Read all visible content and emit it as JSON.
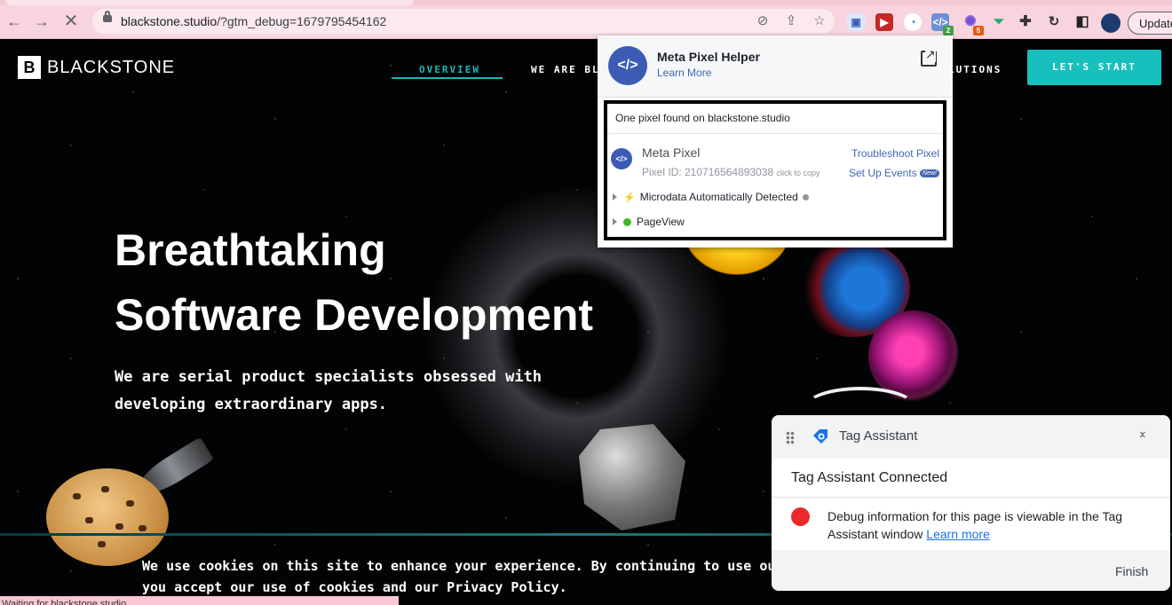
{
  "browser": {
    "url_host": "blackstone.studio",
    "url_path": "/?gtm_debug=1679795454162",
    "update_label": "Update",
    "status_text": "Waiting for blackstone.studio...",
    "extensions": [
      {
        "icon": "extension-icon-1"
      },
      {
        "icon": "extension-icon-2"
      },
      {
        "icon": "extension-icon-3"
      },
      {
        "icon": "meta-pixel-helper-icon",
        "badge": "2"
      },
      {
        "icon": "extension-icon-5",
        "badge": "5"
      },
      {
        "icon": "extension-icon-6"
      },
      {
        "icon": "puzzle-icon"
      }
    ]
  },
  "site": {
    "logo_mark": "B",
    "logo_text": "BLACKSTONE",
    "nav": {
      "overview": "OVERVIEW",
      "we_are": "WE ARE BL",
      "solutions": "LUTIONS"
    },
    "cta": "LET'S START",
    "hero": {
      "line1": "Breathtaking",
      "line2": "Software Development",
      "sub1": "We are serial product specialists obsessed with",
      "sub2": "developing extraordinary apps."
    },
    "cookie": {
      "line1": "We use cookies on this site to enhance your experience. By continuing to use ou",
      "line2": "you accept our use of cookies and our Privacy Policy."
    }
  },
  "pixel_helper": {
    "title": "Meta Pixel Helper",
    "learn_more": "Learn More",
    "found": "One pixel found on blackstone.studio",
    "pixel_name": "Meta Pixel",
    "pixel_id": "Pixel ID: 210716564893038",
    "click_to_copy": "click to copy",
    "troubleshoot": "Troubleshoot Pixel",
    "setup_events": "Set Up Events",
    "new_badge": "New!",
    "microdata": "Microdata Automatically Detected",
    "pageview": "PageView"
  },
  "tag_assistant": {
    "title": "Tag Assistant",
    "connected": "Tag Assistant Connected",
    "message": "Debug information for this page is viewable in the Tag Assistant window",
    "learn_more": "Learn more",
    "finish": "Finish"
  }
}
